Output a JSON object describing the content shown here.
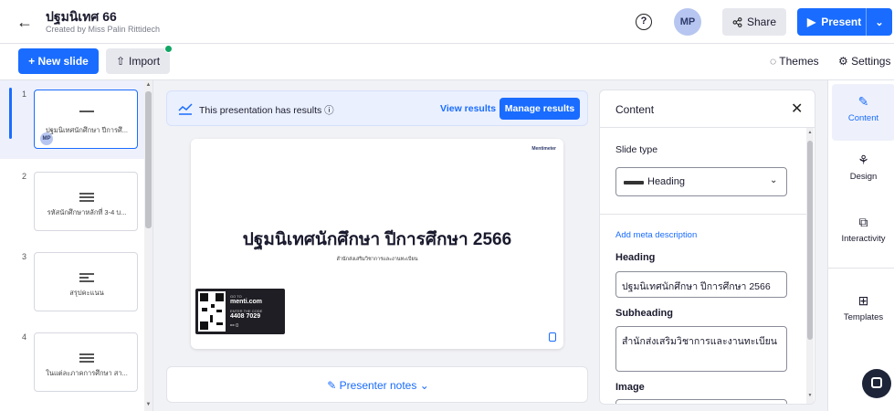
{
  "header": {
    "back_icon": "arrow-left-icon",
    "title": "ปฐมนิเทศ 66",
    "subtitle": "Created by Miss Palin Rittidech",
    "help_glyph": "?",
    "avatar": "MP",
    "share": "Share",
    "present": "Present"
  },
  "toolbar": {
    "new_slide": "+ New slide",
    "import": "Import",
    "themes": "Themes",
    "settings": "Settings"
  },
  "slides": [
    {
      "num": "1",
      "label": "ปฐมนิเทศนักศึกษา ปีการศึ...",
      "avatar": "MP"
    },
    {
      "num": "2",
      "label": "รหัสนักศึกษาหลักที่ 3-4 บ..."
    },
    {
      "num": "3",
      "label": "สรุปคะแนน"
    },
    {
      "num": "4",
      "label": "ในแต่ละภาคการศึกษา สา..."
    }
  ],
  "results": {
    "text": "This presentation has results",
    "view": "View results",
    "manage": "Manage results"
  },
  "canvas": {
    "brand": "Mentimeter",
    "heading": "ปฐมนิเทศนักศึกษา ปีการศึกษา 2566",
    "subheading": "สำนักส่งเสริมวิชาการและงานทะเบียน",
    "qr": {
      "go_to": "GO TO",
      "site": "menti.com",
      "enter": "ENTER THE CODE",
      "code": "4408 7029",
      "count": "0"
    }
  },
  "notes": {
    "label": "Presenter notes"
  },
  "panel": {
    "title": "Content",
    "slide_type_label": "Slide type",
    "slide_type_value": "Heading",
    "meta": "Add meta description",
    "heading_label": "Heading",
    "heading_value": "ปฐมนิเทศนักศึกษา ปีการศึกษา 2566",
    "subheading_label": "Subheading",
    "subheading_value": "สำนักส่งเสริมวิชาการและงานทะเบียน",
    "image_label": "Image"
  },
  "rail": [
    {
      "label": "Content",
      "icon": "pencil-icon"
    },
    {
      "label": "Design",
      "icon": "paint-icon"
    },
    {
      "label": "Interactivity",
      "icon": "layers-icon"
    },
    {
      "label": "Templates",
      "icon": "grid-icon"
    }
  ],
  "colors": {
    "accent": "#196cff",
    "import_badge": "#11a664"
  }
}
